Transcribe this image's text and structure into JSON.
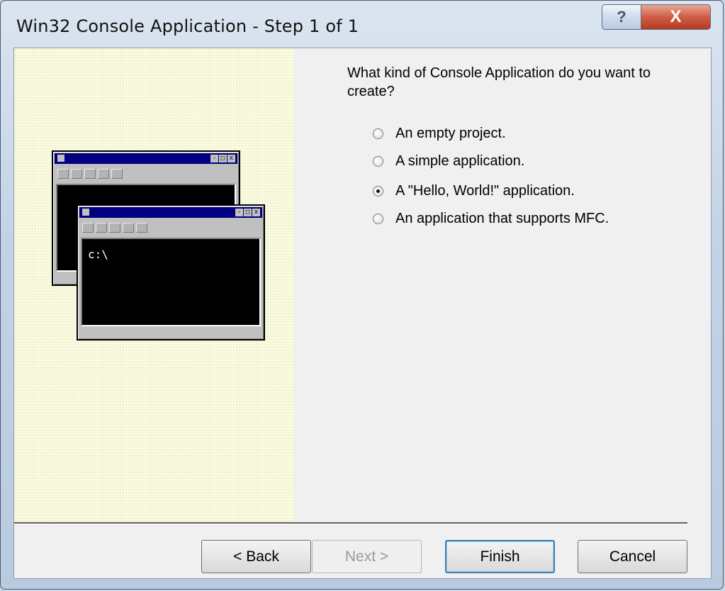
{
  "window": {
    "title": "Win32 Console Application - Step 1 of 1",
    "help_glyph": "?",
    "close_glyph": "X"
  },
  "illustration": {
    "prompt": "c:\\",
    "caption_button_glyphs": [
      "-",
      "□",
      "x"
    ]
  },
  "question": "What kind of Console Application do you want to create?",
  "options": [
    {
      "label": "An empty project.",
      "selected": false
    },
    {
      "label": "A simple application.",
      "selected": false
    },
    {
      "label": "A \"Hello, World!\" application.",
      "selected": true
    },
    {
      "label": "An application that supports MFC.",
      "selected": false
    }
  ],
  "buttons": {
    "back": "< Back",
    "next": "Next >",
    "finish": "Finish",
    "cancel": "Cancel"
  },
  "colors": {
    "illustration_caption": "#000080",
    "left_pane_bg": "#fbfbe2",
    "close_button": "#cf5d45"
  }
}
